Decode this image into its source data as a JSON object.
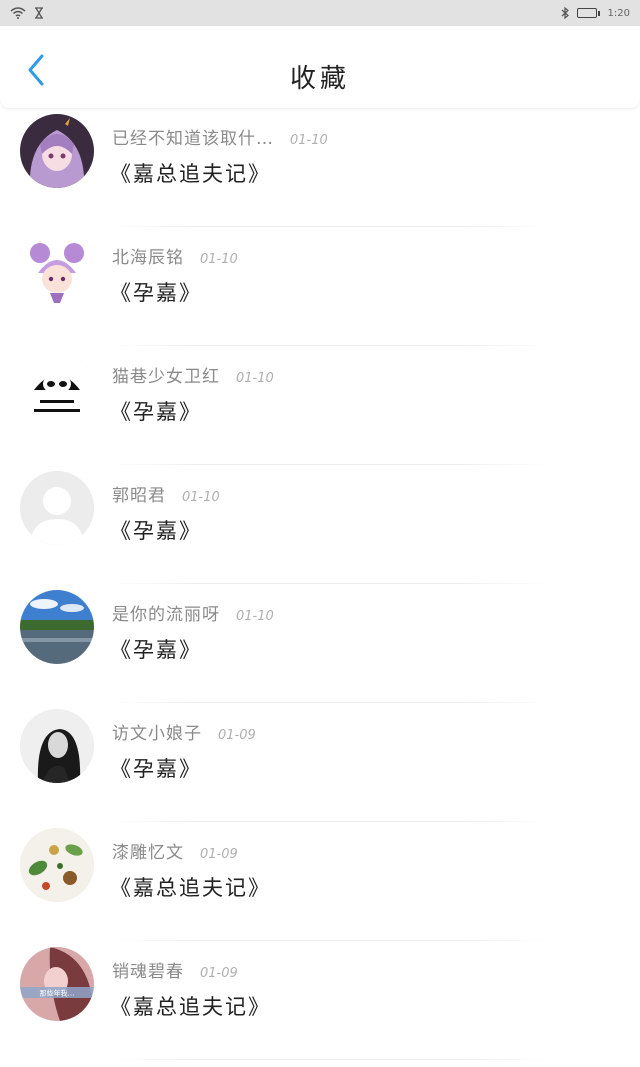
{
  "status_bar": {
    "time": "1:20"
  },
  "header": {
    "title": "收藏"
  },
  "items": [
    {
      "author": "已经不知道该取什…",
      "date": "01-10",
      "book": "《嘉总追夫记》",
      "avatar": "anime-girl-purple"
    },
    {
      "author": "北海辰铭",
      "date": "01-10",
      "book": "《孕嘉》",
      "avatar": "chibi-purple-buns"
    },
    {
      "author": "猫巷少女卫红",
      "date": "01-10",
      "book": "《孕嘉》",
      "avatar": "panda-meme"
    },
    {
      "author": "郭昭君",
      "date": "01-10",
      "book": "《孕嘉》",
      "avatar": "default-avatar"
    },
    {
      "author": "是你的流丽呀",
      "date": "01-10",
      "book": "《孕嘉》",
      "avatar": "landscape-lake"
    },
    {
      "author": "访文小娘子",
      "date": "01-09",
      "book": "《孕嘉》",
      "avatar": "bw-portrait"
    },
    {
      "author": "漆雕忆文",
      "date": "01-09",
      "book": "《嘉总追夫记》",
      "avatar": "botanical-spices"
    },
    {
      "author": "销魂碧春",
      "date": "01-09",
      "book": "《嘉总追夫记》",
      "avatar": "pink-portrait",
      "avatar_text": "那些年我…"
    }
  ],
  "colors": {
    "accent": "#2f9be6",
    "author": "#8a8a8a",
    "date": "#b0b0b0",
    "book": "#222222"
  }
}
